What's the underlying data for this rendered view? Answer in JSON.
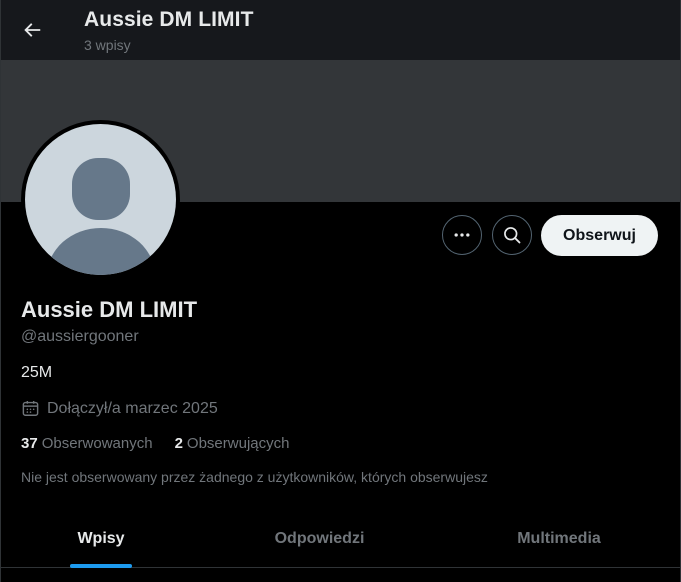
{
  "header": {
    "title": "Aussie DM LIMIT",
    "posts_count": "3 wpisy"
  },
  "profile": {
    "display_name": "Aussie DM LIMIT",
    "handle": "@aussiergooner",
    "bio": "25M",
    "joined": "Dołączył/a marzec 2025",
    "following_count": "37",
    "following_label": "Obserwowanych",
    "followers_count": "2",
    "followers_label": "Obserwujących",
    "not_followed_note": "Nie jest obserwowany przez żadnego z użytkowników, których obserwujesz"
  },
  "actions": {
    "more_icon": "more-dots-icon",
    "search_icon": "search-icon",
    "follow_label": "Obserwuj"
  },
  "tabs": [
    {
      "label": "Wpisy",
      "active": true
    },
    {
      "label": "Odpowiedzi",
      "active": false
    },
    {
      "label": "Multimedia",
      "active": false
    }
  ],
  "colors": {
    "accent": "#1d9bf0",
    "banner": "#333639",
    "avatar_bg": "#ccd6dd",
    "avatar_fg": "#66788a"
  }
}
